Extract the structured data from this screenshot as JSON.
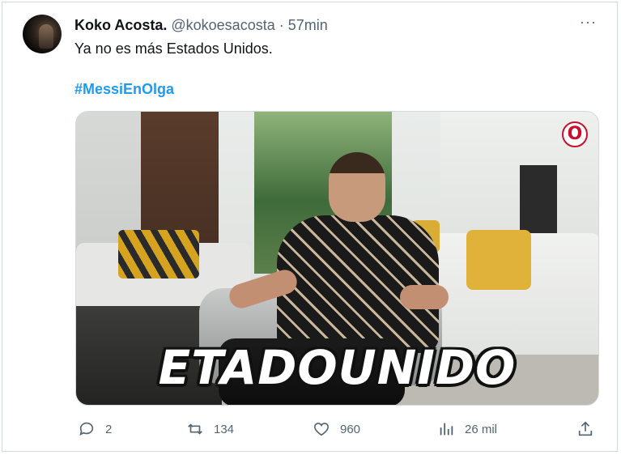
{
  "tweet": {
    "author_name": "Koko Acosta.",
    "handle": "@kokoesacosta",
    "separator": "·",
    "time": "57min",
    "more": "···",
    "text": "Ya no es más Estados Unidos.",
    "hashtag": "#MessiEnOlga",
    "media": {
      "caption": "ETADOUNIDO",
      "logo": "O"
    },
    "actions": {
      "replies": "2",
      "retweets": "134",
      "likes": "960",
      "views": "26 mil"
    }
  },
  "colors": {
    "accent": "#1d9bf0",
    "muted": "#536471",
    "text": "#0f1419",
    "border": "#cfd9de"
  },
  "icons": [
    "reply-icon",
    "retweet-icon",
    "like-icon",
    "views-icon",
    "share-icon",
    "more-icon"
  ]
}
